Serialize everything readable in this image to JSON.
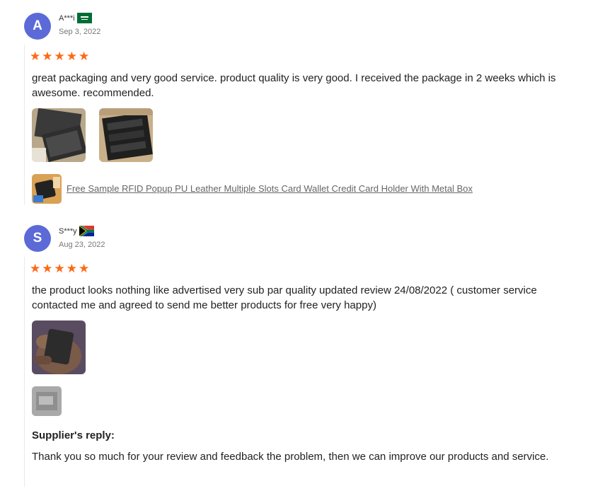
{
  "reviews": [
    {
      "avatar_letter": "A",
      "avatar_color": "#5b6ad6",
      "username": "A***i",
      "flag": "saudi-arabia-flag",
      "date": "Sep 3, 2022",
      "rating": 5,
      "text": "great packaging and very good service. product quality is very good. I received the package in 2 weeks which is awesome. recommended.",
      "photos": [
        "wallet-photo-1",
        "wallet-photo-2"
      ],
      "product_link": "Free Sample RFID Popup PU Leather Multiple Slots Card Wallet Credit Card Holder With Metal Box"
    },
    {
      "avatar_letter": "S",
      "avatar_color": "#5b6ad6",
      "username": "S***y",
      "flag": "south-africa-flag",
      "date": "Aug 23, 2022",
      "rating": 5,
      "text": "the product looks nothing like advertised very sub par quality updated review 24/08/2022 ( customer service contacted me and agreed to send me better products for free very happy)",
      "photos": [
        "hand-holding-wallet-photo"
      ],
      "extra_thumb": "blurred-thumbnail",
      "supplier_reply_title": "Supplier's reply:",
      "supplier_reply_text": "Thank you so much for your review and feedback the problem, then we can improve our products and service."
    }
  ],
  "colors": {
    "star": "#fc6a15",
    "avatar": "#5b6ad6"
  }
}
